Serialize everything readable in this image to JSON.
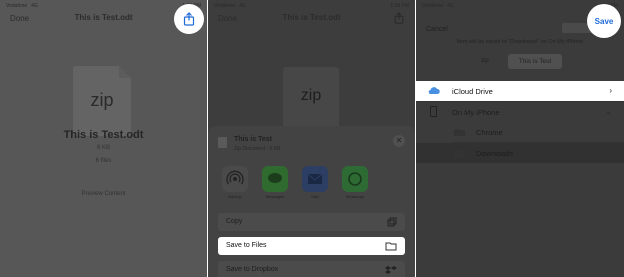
{
  "colors": {
    "accent": "#1f6bd8",
    "overlay": "#575757",
    "highlight": "#ffffff"
  },
  "panel1": {
    "status": {
      "carrier": "Vodafone",
      "network": "4G",
      "time": "1:58 PM"
    },
    "done_label": "Done",
    "title": "This is Test.odt",
    "doc_ext": "zip",
    "file_name": "This is Test.odt",
    "file_size": "6 KB",
    "file_count": "6 files",
    "preview_label": "Preview Content"
  },
  "panel2": {
    "status": {
      "carrier": "Vodafone",
      "network": "4G",
      "time": "1:58 PM"
    },
    "done_label": "Done",
    "title": "This is Test.odt",
    "doc_ext": "zip",
    "sheet_title": "This is Test",
    "sheet_subtitle": "Zip Document · 6 KB",
    "apps": [
      {
        "label": "AirDrop",
        "icon": "airdrop-icon",
        "color": "#4a4a4a"
      },
      {
        "label": "Messages",
        "icon": "messages-icon",
        "color": "#2f6b2f"
      },
      {
        "label": "Mail",
        "icon": "mail-icon",
        "color": "#2c3e63"
      },
      {
        "label": "WhatsApp",
        "icon": "whatsapp-icon",
        "color": "#2e6b34"
      }
    ],
    "actions": [
      {
        "label": "Copy",
        "icon": "copy-icon"
      },
      {
        "label": "Save to Files",
        "icon": "folder-icon"
      },
      {
        "label": "Save to Dropbox",
        "icon": "dropbox-icon"
      }
    ]
  },
  "panel3": {
    "status": {
      "carrier": "Vodafone",
      "network": "4G",
      "time": "1:58 PM"
    },
    "cancel_label": "Cancel",
    "save_label": "Save",
    "note": "Item will be saved to \"Downloads\" on On My iPhone",
    "doc_ext": "zip",
    "file_name": "This is Test",
    "locations": [
      {
        "label": "iCloud Drive",
        "icon": "cloud-icon"
      },
      {
        "label": "On My iPhone",
        "icon": "phone-icon"
      },
      {
        "label": "Chrome",
        "icon": "folder-icon"
      },
      {
        "label": "Downloads",
        "icon": "folder-icon"
      }
    ]
  }
}
